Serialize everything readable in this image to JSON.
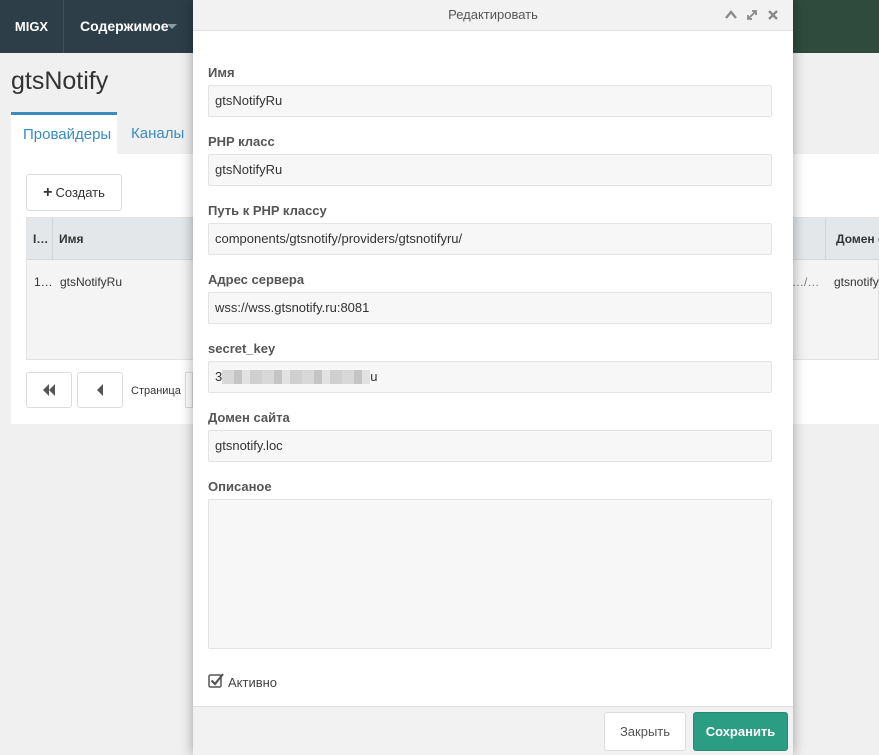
{
  "topbar": {
    "brand": "MIGX",
    "menu_label": "Содержимое"
  },
  "page": {
    "title": "gtsNotify",
    "tabs": [
      {
        "label": "Провайдеры"
      },
      {
        "label": "Каналы"
      }
    ],
    "create_button": "Создать",
    "grid": {
      "headers": [
        "I…",
        "Имя",
        "Домен с"
      ],
      "rows": [
        {
          "id": "1…",
          "name": "gtsNotifyRu",
          "extra": "…/…",
          "domain": "gtsnotify"
        }
      ]
    },
    "pager_label": "Страница"
  },
  "modal": {
    "title": "Редактировать",
    "fields": [
      {
        "label": "Имя",
        "value": "gtsNotifyRu"
      },
      {
        "label": "PHP класс",
        "value": "gtsNotifyRu"
      },
      {
        "label": "Путь к PHP классу",
        "value": "components/gtsnotify/providers/gtsnotifyru/"
      },
      {
        "label": "Адрес сервера",
        "value": "wss://wss.gtsnotify.ru:8081"
      },
      {
        "label": "secret_key",
        "value_start": "3",
        "value_end": "u"
      },
      {
        "label": "Домен сайта",
        "value": "gtsnotify.loc"
      },
      {
        "label": "Описаное",
        "value": ""
      }
    ],
    "active_label": "Активно",
    "active_checked": true,
    "close_button": "Закрыть",
    "save_button": "Сохранить"
  },
  "colors": {
    "navbar": "#2d3e48",
    "accent": "#3b8bc1",
    "save": "#2a9d82"
  }
}
